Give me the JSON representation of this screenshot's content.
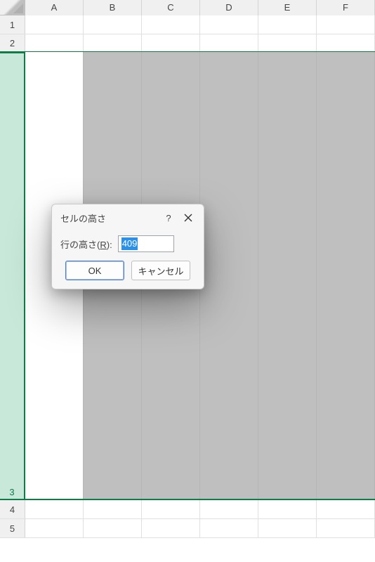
{
  "columns": {
    "A": "A",
    "B": "B",
    "C": "C",
    "D": "D",
    "E": "E",
    "F": "F"
  },
  "rows": {
    "r1": "1",
    "r2": "2",
    "r3": "3",
    "r4": "4",
    "r5": "5"
  },
  "dialog": {
    "title": "セルの高さ",
    "help_tooltip": "?",
    "label_prefix": "行の高さ(",
    "label_accel": "R",
    "label_suffix": "):",
    "value": "409",
    "ok_label": "OK",
    "cancel_label": "キャンセル"
  }
}
